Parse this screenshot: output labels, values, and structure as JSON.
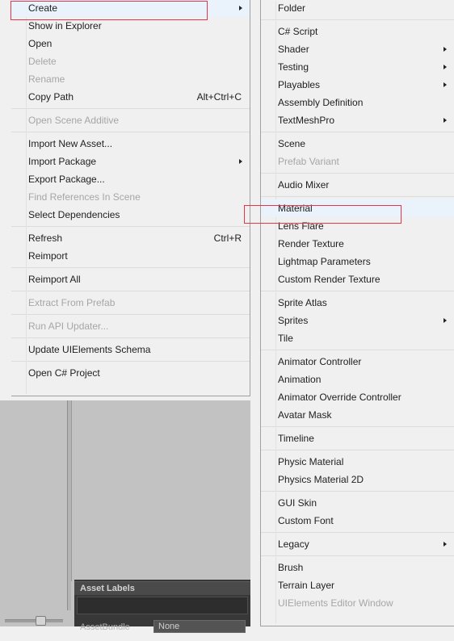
{
  "app": {
    "name": "Unity Editor",
    "accent_highlight": "#eaf2fb",
    "annotation_color": "#e8344a",
    "menu_bg": "#f0f0f0",
    "panel_bg": "#c2c2c2",
    "inspector_bg": "#383838"
  },
  "context_menu": {
    "name": "project-asset-context-menu",
    "items": [
      {
        "label": "Create",
        "disabled": false,
        "submenu": true,
        "shortcut": "",
        "separator_after": false,
        "highlighted": true
      },
      {
        "label": "Show in Explorer",
        "disabled": false,
        "submenu": false,
        "shortcut": "",
        "separator_after": false
      },
      {
        "label": "Open",
        "disabled": false,
        "submenu": false,
        "shortcut": "",
        "separator_after": false
      },
      {
        "label": "Delete",
        "disabled": true,
        "submenu": false,
        "shortcut": "",
        "separator_after": false
      },
      {
        "label": "Rename",
        "disabled": true,
        "submenu": false,
        "shortcut": "",
        "separator_after": false
      },
      {
        "label": "Copy Path",
        "disabled": false,
        "submenu": false,
        "shortcut": "Alt+Ctrl+C",
        "separator_after": true
      },
      {
        "label": "Open Scene Additive",
        "disabled": true,
        "submenu": false,
        "shortcut": "",
        "separator_after": true
      },
      {
        "label": "Import New Asset...",
        "disabled": false,
        "submenu": false,
        "shortcut": "",
        "separator_after": false
      },
      {
        "label": "Import Package",
        "disabled": false,
        "submenu": true,
        "shortcut": "",
        "separator_after": false
      },
      {
        "label": "Export Package...",
        "disabled": false,
        "submenu": false,
        "shortcut": "",
        "separator_after": false
      },
      {
        "label": "Find References In Scene",
        "disabled": true,
        "submenu": false,
        "shortcut": "",
        "separator_after": false
      },
      {
        "label": "Select Dependencies",
        "disabled": false,
        "submenu": false,
        "shortcut": "",
        "separator_after": true
      },
      {
        "label": "Refresh",
        "disabled": false,
        "submenu": false,
        "shortcut": "Ctrl+R",
        "separator_after": false
      },
      {
        "label": "Reimport",
        "disabled": false,
        "submenu": false,
        "shortcut": "",
        "separator_after": true
      },
      {
        "label": "Reimport All",
        "disabled": false,
        "submenu": false,
        "shortcut": "",
        "separator_after": true
      },
      {
        "label": "Extract From Prefab",
        "disabled": true,
        "submenu": false,
        "shortcut": "",
        "separator_after": true
      },
      {
        "label": "Run API Updater...",
        "disabled": true,
        "submenu": false,
        "shortcut": "",
        "separator_after": true
      },
      {
        "label": "Update UIElements Schema",
        "disabled": false,
        "submenu": false,
        "shortcut": "",
        "separator_after": true
      },
      {
        "label": "Open C# Project",
        "disabled": false,
        "submenu": false,
        "shortcut": "",
        "separator_after": false
      }
    ]
  },
  "submenu": {
    "name": "create-submenu",
    "items": [
      {
        "label": "Folder",
        "disabled": false,
        "submenu": false,
        "separator_after": true
      },
      {
        "label": "C# Script",
        "disabled": false,
        "submenu": false,
        "separator_after": false
      },
      {
        "label": "Shader",
        "disabled": false,
        "submenu": true,
        "separator_after": false
      },
      {
        "label": "Testing",
        "disabled": false,
        "submenu": true,
        "separator_after": false
      },
      {
        "label": "Playables",
        "disabled": false,
        "submenu": true,
        "separator_after": false
      },
      {
        "label": "Assembly Definition",
        "disabled": false,
        "submenu": false,
        "separator_after": false
      },
      {
        "label": "TextMeshPro",
        "disabled": false,
        "submenu": true,
        "separator_after": true
      },
      {
        "label": "Scene",
        "disabled": false,
        "submenu": false,
        "separator_after": false
      },
      {
        "label": "Prefab Variant",
        "disabled": true,
        "submenu": false,
        "separator_after": true
      },
      {
        "label": "Audio Mixer",
        "disabled": false,
        "submenu": false,
        "separator_after": true
      },
      {
        "label": "Material",
        "disabled": false,
        "submenu": false,
        "separator_after": false,
        "highlighted": true
      },
      {
        "label": "Lens Flare",
        "disabled": false,
        "submenu": false,
        "separator_after": false
      },
      {
        "label": "Render Texture",
        "disabled": false,
        "submenu": false,
        "separator_after": false
      },
      {
        "label": "Lightmap Parameters",
        "disabled": false,
        "submenu": false,
        "separator_after": false
      },
      {
        "label": "Custom Render Texture",
        "disabled": false,
        "submenu": false,
        "separator_after": true
      },
      {
        "label": "Sprite Atlas",
        "disabled": false,
        "submenu": false,
        "separator_after": false
      },
      {
        "label": "Sprites",
        "disabled": false,
        "submenu": true,
        "separator_after": false
      },
      {
        "label": "Tile",
        "disabled": false,
        "submenu": false,
        "separator_after": true
      },
      {
        "label": "Animator Controller",
        "disabled": false,
        "submenu": false,
        "separator_after": false
      },
      {
        "label": "Animation",
        "disabled": false,
        "submenu": false,
        "separator_after": false
      },
      {
        "label": "Animator Override Controller",
        "disabled": false,
        "submenu": false,
        "separator_after": false
      },
      {
        "label": "Avatar Mask",
        "disabled": false,
        "submenu": false,
        "separator_after": true
      },
      {
        "label": "Timeline",
        "disabled": false,
        "submenu": false,
        "separator_after": true
      },
      {
        "label": "Physic Material",
        "disabled": false,
        "submenu": false,
        "separator_after": false
      },
      {
        "label": "Physics Material 2D",
        "disabled": false,
        "submenu": false,
        "separator_after": true
      },
      {
        "label": "GUI Skin",
        "disabled": false,
        "submenu": false,
        "separator_after": false
      },
      {
        "label": "Custom Font",
        "disabled": false,
        "submenu": false,
        "separator_after": true
      },
      {
        "label": "Legacy",
        "disabled": false,
        "submenu": true,
        "separator_after": true
      },
      {
        "label": "Brush",
        "disabled": false,
        "submenu": false,
        "separator_after": false
      },
      {
        "label": "Terrain Layer",
        "disabled": false,
        "submenu": false,
        "separator_after": false
      },
      {
        "label": "UIElements Editor Window",
        "disabled": true,
        "submenu": false,
        "separator_after": false
      }
    ]
  },
  "inspector": {
    "asset_labels_title": "Asset Labels",
    "assetbundle_label": "AssetBundle",
    "assetbundle_value": "None"
  }
}
